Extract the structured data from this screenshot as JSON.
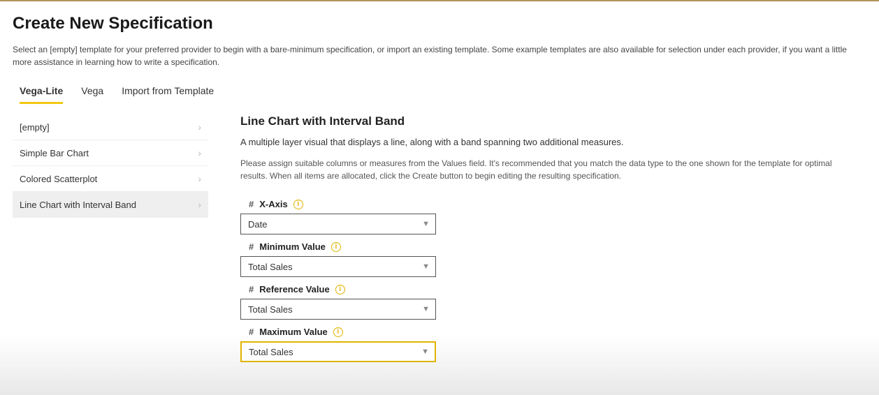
{
  "header": {
    "title": "Create New Specification"
  },
  "intro": "Select an [empty] template for your preferred provider to begin with a bare-minimum specification, or import an existing template. Some example templates are also available for selection under each provider, if you want a little more assistance in learning how to write a specification.",
  "tabs": [
    {
      "label": "Vega-Lite",
      "selected": true
    },
    {
      "label": "Vega",
      "selected": false
    },
    {
      "label": "Import from Template",
      "selected": false
    }
  ],
  "sidebar": {
    "items": [
      {
        "label": "[empty]",
        "selected": false
      },
      {
        "label": "Simple Bar Chart",
        "selected": false
      },
      {
        "label": "Colored Scatterplot",
        "selected": false
      },
      {
        "label": "Line Chart with Interval Band",
        "selected": true
      }
    ]
  },
  "main": {
    "title": "Line Chart with Interval Band",
    "subtitle": "A multiple layer visual that displays a line, along with a band spanning two additional measures.",
    "help": "Please assign suitable columns or measures from the Values field. It's recommended that you match the data type to the one shown for the template for optimal results. When all items are allocated, click the Create button to begin editing the resulting specification.",
    "fields": [
      {
        "label": "X-Axis",
        "value": "Date",
        "focused": false
      },
      {
        "label": "Minimum Value",
        "value": "Total Sales",
        "focused": false
      },
      {
        "label": "Reference Value",
        "value": "Total Sales",
        "focused": false
      },
      {
        "label": "Maximum Value",
        "value": "Total Sales",
        "focused": true
      }
    ]
  }
}
